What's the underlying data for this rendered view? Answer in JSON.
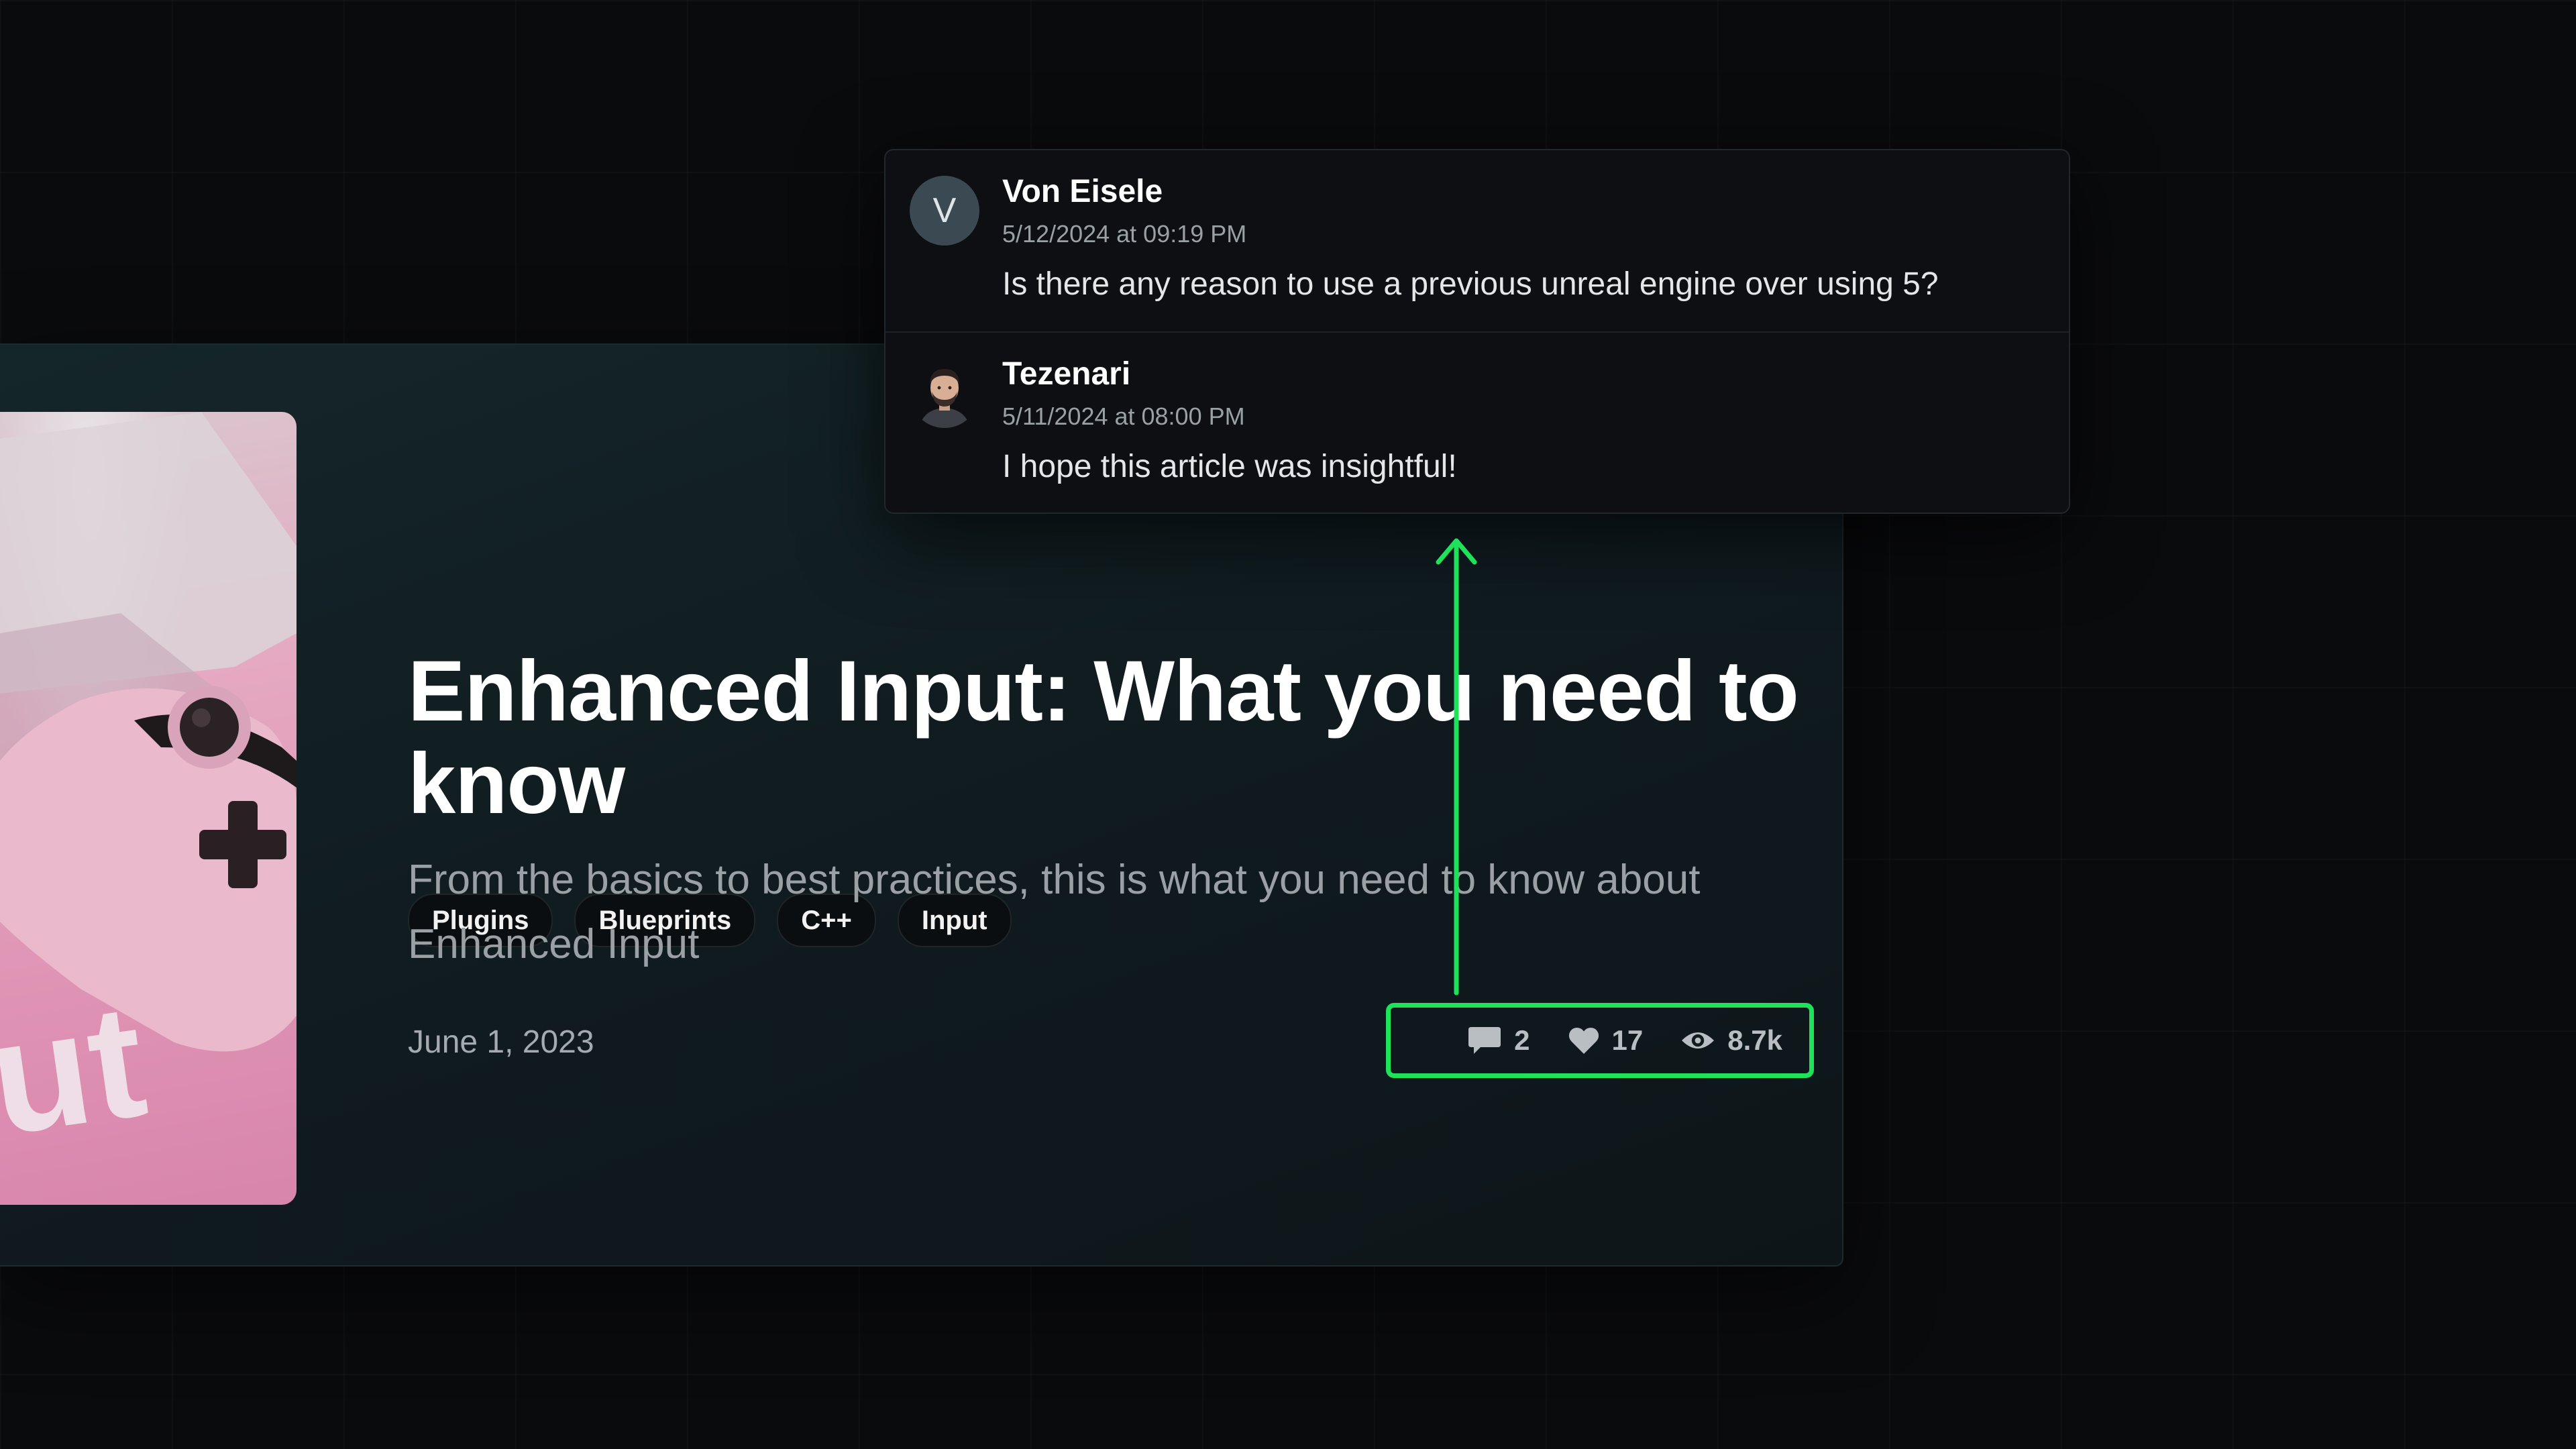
{
  "article": {
    "tags": [
      "Plugins",
      "Blueprints",
      "C++",
      "Input"
    ],
    "title": "Enhanced Input: What you need to know",
    "subtitle": "From the basics to best practices, this is what you need to know about Enhanced Input",
    "date": "June 1, 2023",
    "thumbnail_text": "ut",
    "stats": {
      "comments": "2",
      "likes": "17",
      "views": "8.7k"
    }
  },
  "comments": [
    {
      "avatar_letter": "V",
      "author": "Von Eisele",
      "time": "5/12/2024 at 09:19 PM",
      "text": "Is there any reason to use a previous unreal engine over using 5?"
    },
    {
      "author": "Tezenari",
      "time": "5/11/2024 at 08:00 PM",
      "text": "I hope this article was insightful!"
    }
  ],
  "colors": {
    "highlight": "#1ee35a",
    "background": "#0a0b0d",
    "card": "#101c20",
    "muted_text": "#9aa0a4"
  },
  "icons": [
    "comment-icon",
    "heart-icon",
    "eye-icon"
  ]
}
